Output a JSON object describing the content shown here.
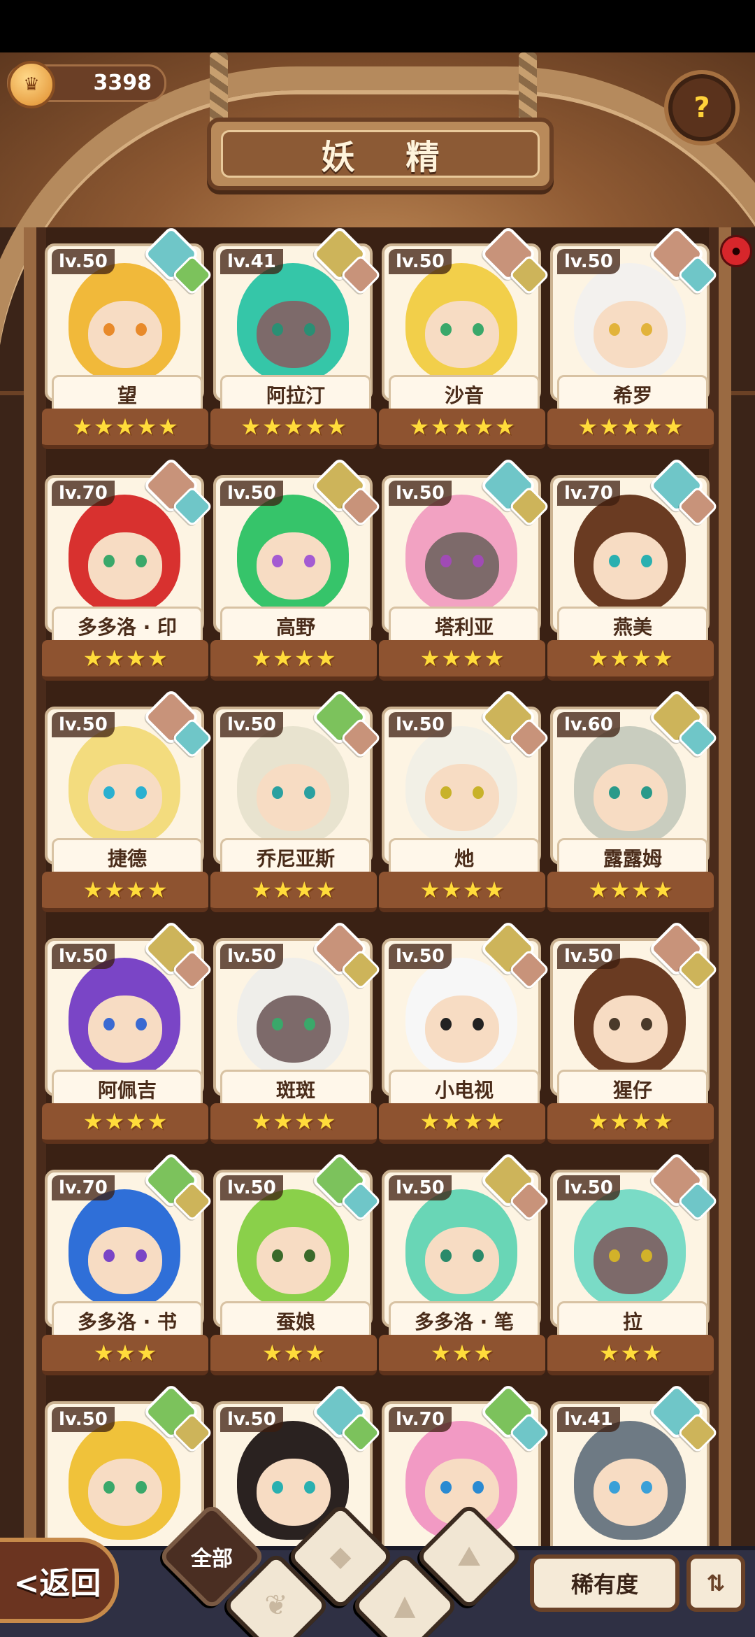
{
  "header": {
    "title": "妖 精",
    "coin": "3398",
    "help_icon": "question-lightbulb-icon"
  },
  "cards": [
    {
      "level": "lv.50",
      "name": "望",
      "stars": 5,
      "element": "water",
      "sub": "leaf",
      "hair": "#f1b93a",
      "eye": "#e88a2a"
    },
    {
      "level": "lv.41",
      "name": "阿拉汀",
      "stars": 5,
      "element": "earth",
      "sub": "rock",
      "hair": "#35c6a8",
      "eye": "#2a8f74",
      "dark": true
    },
    {
      "level": "lv.50",
      "name": "沙音",
      "stars": 5,
      "element": "rock",
      "sub": "earth",
      "hair": "#f2cf4a",
      "eye": "#3aa86a"
    },
    {
      "level": "lv.50",
      "name": "希罗",
      "stars": 5,
      "element": "rock",
      "sub": "water",
      "hair": "#f3f1ee",
      "eye": "#e2b33a"
    },
    {
      "level": "lv.70",
      "name": "多多洛 · 印",
      "stars": 4,
      "element": "rock",
      "sub": "water",
      "hair": "#d8312f",
      "eye": "#3aa86a"
    },
    {
      "level": "lv.50",
      "name": "高野",
      "stars": 4,
      "element": "earth",
      "sub": "rock",
      "hair": "#36c46a",
      "eye": "#a45bd2"
    },
    {
      "level": "lv.50",
      "name": "塔利亚",
      "stars": 4,
      "element": "water",
      "sub": "earth",
      "hair": "#f2a2c2",
      "eye": "#a04bb5",
      "dark": true
    },
    {
      "level": "lv.70",
      "name": "燕美",
      "stars": 4,
      "element": "water",
      "sub": "rock",
      "hair": "#6a3b22",
      "eye": "#2ab0b0"
    },
    {
      "level": "lv.50",
      "name": "捷德",
      "stars": 4,
      "element": "rock",
      "sub": "water",
      "hair": "#f3dc7e",
      "eye": "#2ab0d0"
    },
    {
      "level": "lv.50",
      "name": "乔尼亚斯",
      "stars": 4,
      "element": "leaf",
      "sub": "rock",
      "hair": "#e8e3cf",
      "eye": "#2aa0a0"
    },
    {
      "level": "lv.50",
      "name": "灺",
      "stars": 4,
      "element": "earth",
      "sub": "rock",
      "hair": "#f2f0e6",
      "eye": "#c8b22a"
    },
    {
      "level": "lv.60",
      "name": "露露姆",
      "stars": 4,
      "element": "earth",
      "sub": "water",
      "hair": "#c9cdbf",
      "eye": "#2a9a8a"
    },
    {
      "level": "lv.50",
      "name": "阿佩吉",
      "stars": 4,
      "element": "earth",
      "sub": "rock",
      "hair": "#7a45c6",
      "eye": "#3a6ad2"
    },
    {
      "level": "lv.50",
      "name": "斑斑",
      "stars": 4,
      "element": "rock",
      "sub": "earth",
      "hair": "#efeeea",
      "eye": "#3aa86a",
      "dark": true
    },
    {
      "level": "lv.50",
      "name": "小电视",
      "stars": 4,
      "element": "earth",
      "sub": "rock",
      "hair": "#f7f7f7",
      "eye": "#222"
    },
    {
      "level": "lv.50",
      "name": "猩仔",
      "stars": 4,
      "element": "rock",
      "sub": "earth",
      "hair": "#6a3b22",
      "eye": "#4a3a2a"
    },
    {
      "level": "lv.70",
      "name": "多多洛 · 书",
      "stars": 3,
      "element": "leaf",
      "sub": "earth",
      "hair": "#2f6fd8",
      "eye": "#7a45c6"
    },
    {
      "level": "lv.50",
      "name": "蚕娘",
      "stars": 3,
      "element": "leaf",
      "sub": "water",
      "hair": "#8ad04a",
      "eye": "#3a6a2a"
    },
    {
      "level": "lv.50",
      "name": "多多洛 · 笔",
      "stars": 3,
      "element": "earth",
      "sub": "rock",
      "hair": "#69d6b6",
      "eye": "#2a8a6a"
    },
    {
      "level": "lv.50",
      "name": "拉",
      "stars": 3,
      "element": "rock",
      "sub": "water",
      "hair": "#7adbc6",
      "eye": "#d2b22a",
      "dark": true
    },
    {
      "level": "lv.50",
      "name": "",
      "stars": 0,
      "element": "leaf",
      "sub": "earth",
      "hair": "#f0c23a",
      "eye": "#3aa86a"
    },
    {
      "level": "lv.50",
      "name": "",
      "stars": 0,
      "element": "water",
      "sub": "leaf",
      "hair": "#2a2220",
      "eye": "#2ab0b0"
    },
    {
      "level": "lv.70",
      "name": "",
      "stars": 0,
      "element": "leaf",
      "sub": "water",
      "hair": "#f29ac4",
      "eye": "#2a8ad2"
    },
    {
      "level": "lv.41",
      "name": "",
      "stars": 0,
      "element": "water",
      "sub": "earth",
      "hair": "#6e7a84",
      "eye": "#3aa0d8"
    }
  ],
  "bottom": {
    "back": "<返回",
    "filter_all": "全部",
    "filters": [
      "water",
      "leaf",
      "rock",
      "earth"
    ],
    "rarity": "稀有度",
    "sort_icon": "sort-icon"
  }
}
